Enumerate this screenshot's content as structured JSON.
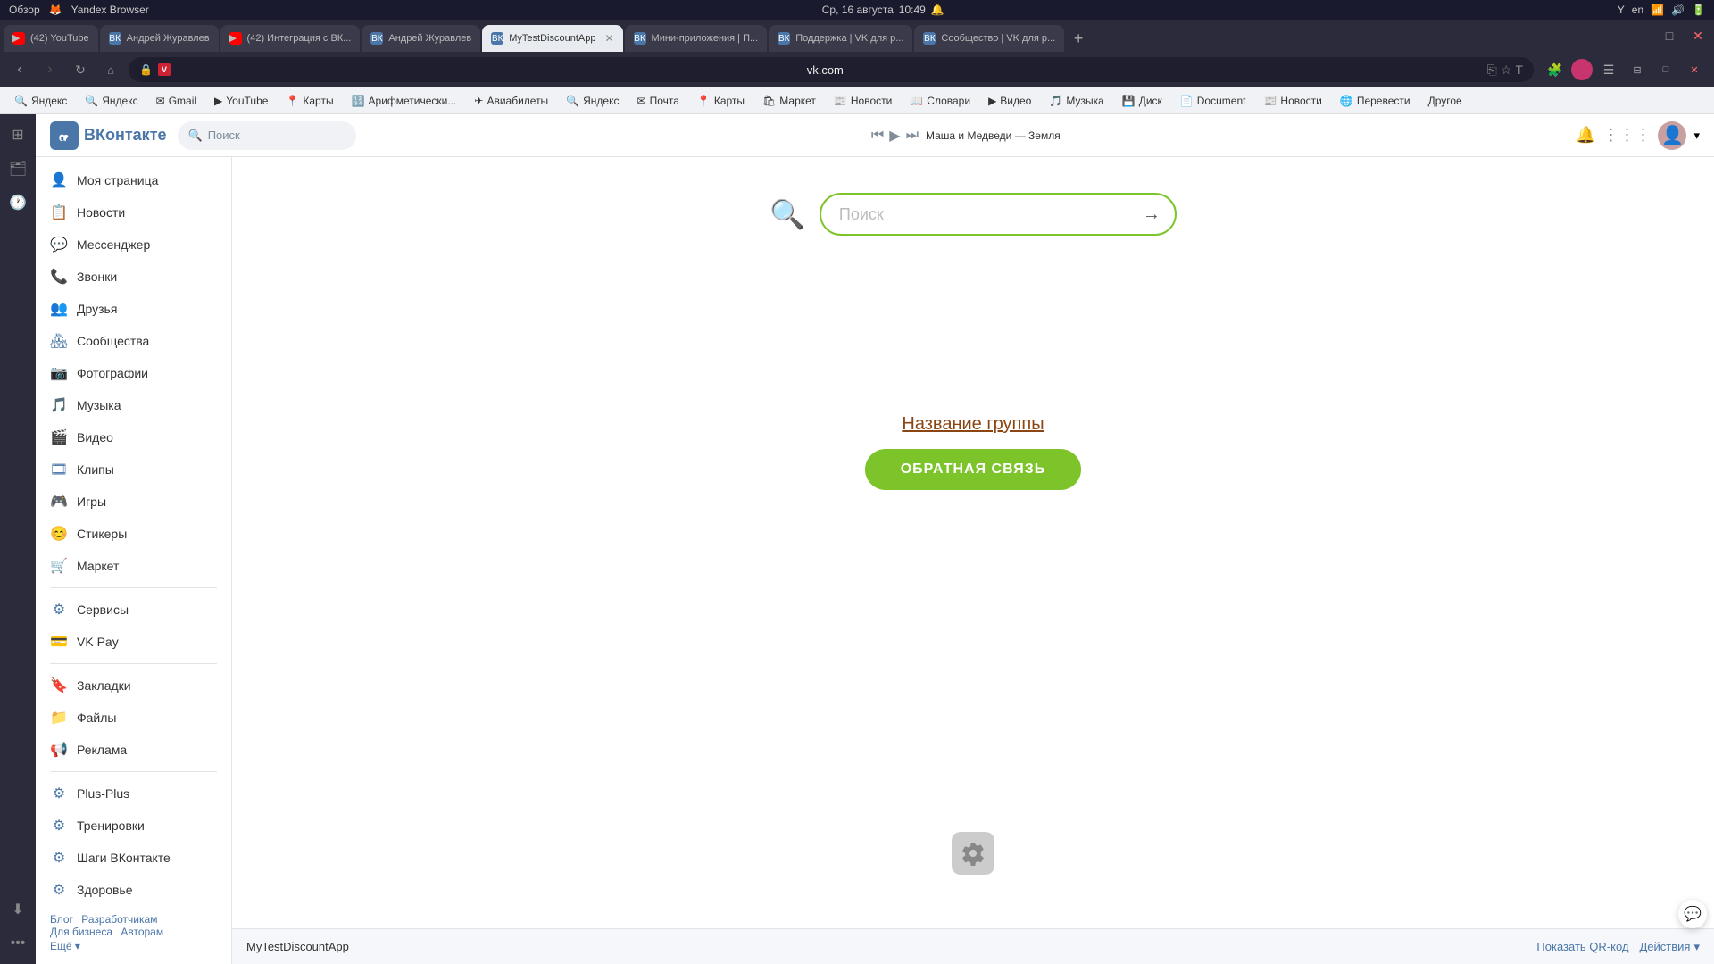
{
  "os_bar": {
    "left_text": "Обзор",
    "browser_name": "Yandex Browser",
    "center_date": "Ср, 16 августа",
    "center_time": "10:49",
    "lang": "en"
  },
  "tabs": [
    {
      "id": "tab1",
      "label": "(42) YouTube",
      "favicon": "yt",
      "active": false
    },
    {
      "id": "tab2",
      "label": "Андрей Журавлев",
      "favicon": "vk",
      "active": false
    },
    {
      "id": "tab3",
      "label": "(42) Интеграция с ВК...",
      "favicon": "yt",
      "active": false
    },
    {
      "id": "tab4",
      "label": "Андрей Журавлев",
      "favicon": "vk",
      "active": false
    },
    {
      "id": "tab5",
      "label": "MyTestDiscountApp",
      "favicon": "vk2",
      "active": true
    },
    {
      "id": "tab6",
      "label": "Мини-приложения | П...",
      "favicon": "vk2",
      "active": false
    },
    {
      "id": "tab7",
      "label": "Поддержка | VK для р...",
      "favicon": "vk2",
      "active": false
    },
    {
      "id": "tab8",
      "label": "Сообщество | VK для р...",
      "favicon": "vk2",
      "active": false
    }
  ],
  "address_bar": {
    "url": "vk.com",
    "page_title": "MyTestDiscountApp"
  },
  "bookmarks": [
    {
      "label": "Яндекс",
      "icon": "🔍"
    },
    {
      "label": "Яндекс",
      "icon": "🔍"
    },
    {
      "label": "Gmail",
      "icon": "✉"
    },
    {
      "label": "YouTube",
      "icon": "▶"
    },
    {
      "label": "Карты",
      "icon": "📍"
    },
    {
      "label": "Арифметически...",
      "icon": "🔢"
    },
    {
      "label": "Авиабилеты",
      "icon": "✈"
    },
    {
      "label": "Яндекс",
      "icon": "🔍"
    },
    {
      "label": "Почта",
      "icon": "✉"
    },
    {
      "label": "Карты",
      "icon": "📍"
    },
    {
      "label": "Маркет",
      "icon": "🛍"
    },
    {
      "label": "Новости",
      "icon": "📰"
    },
    {
      "label": "Словари",
      "icon": "📖"
    },
    {
      "label": "Видео",
      "icon": "▶"
    },
    {
      "label": "Музыка",
      "icon": "🎵"
    },
    {
      "label": "Диск",
      "icon": "💾"
    },
    {
      "label": "Document",
      "icon": "📄"
    },
    {
      "label": "Новости",
      "icon": "📰"
    },
    {
      "label": "Перевести",
      "icon": "🌐"
    },
    {
      "label": "Другое",
      "icon": "▾"
    }
  ],
  "vk_header": {
    "logo_text": "ВКонтакте",
    "search_placeholder": "Поиск",
    "bell_label": "Уведомления",
    "music_prev": "⏮",
    "music_play": "▶",
    "music_next": "⏭",
    "music_title": "Маша и Медведи — Земля",
    "grid_icon": "⋮⋮⋮",
    "chevron_down": "▾"
  },
  "sidebar": {
    "items": [
      {
        "id": "my-page",
        "label": "Моя страница",
        "icon": "👤"
      },
      {
        "id": "news",
        "label": "Новости",
        "icon": "🗞"
      },
      {
        "id": "messenger",
        "label": "Мессенджер",
        "icon": "💬"
      },
      {
        "id": "calls",
        "label": "Звонки",
        "icon": "📞"
      },
      {
        "id": "friends",
        "label": "Друзья",
        "icon": "👥"
      },
      {
        "id": "communities",
        "label": "Сообщества",
        "icon": "🏘"
      },
      {
        "id": "photos",
        "label": "Фотографии",
        "icon": "📷"
      },
      {
        "id": "music",
        "label": "Музыка",
        "icon": "🎵"
      },
      {
        "id": "video",
        "label": "Видео",
        "icon": "🎬"
      },
      {
        "id": "clips",
        "label": "Клипы",
        "icon": "🎮"
      },
      {
        "id": "games",
        "label": "Игры",
        "icon": "🎮"
      },
      {
        "id": "stickers",
        "label": "Стикеры",
        "icon": "😊"
      },
      {
        "id": "market",
        "label": "Маркет",
        "icon": "🛒"
      },
      {
        "id": "services",
        "label": "Сервисы",
        "icon": "⚙"
      },
      {
        "id": "vkpay",
        "label": "VK Pay",
        "icon": "💳"
      },
      {
        "id": "bookmarks",
        "label": "Закладки",
        "icon": "🔖"
      },
      {
        "id": "files",
        "label": "Файлы",
        "icon": "📁"
      },
      {
        "id": "ads",
        "label": "Реклама",
        "icon": "📢"
      },
      {
        "id": "plusplus",
        "label": "Plus-Plus",
        "icon": "⚙"
      },
      {
        "id": "trainings",
        "label": "Тренировки",
        "icon": "⚙"
      },
      {
        "id": "steps",
        "label": "Шаги ВКонтакте",
        "icon": "⚙"
      },
      {
        "id": "health",
        "label": "Здоровье",
        "icon": "⚙"
      }
    ],
    "footer_links": [
      "Блог",
      "Разработчикам",
      "Для бизнеса",
      "Авторам"
    ],
    "footer_more": "Ещё ▾"
  },
  "app": {
    "search_placeholder": "Поиск",
    "search_arrow": "→",
    "group_name": "Название группы",
    "feedback_btn": "ОБРАТНАЯ СВЯЗЬ",
    "footer_name": "MyTestDiscountApp",
    "show_qr": "Показать QR-код",
    "actions": "Действия",
    "actions_chevron": "▾"
  }
}
